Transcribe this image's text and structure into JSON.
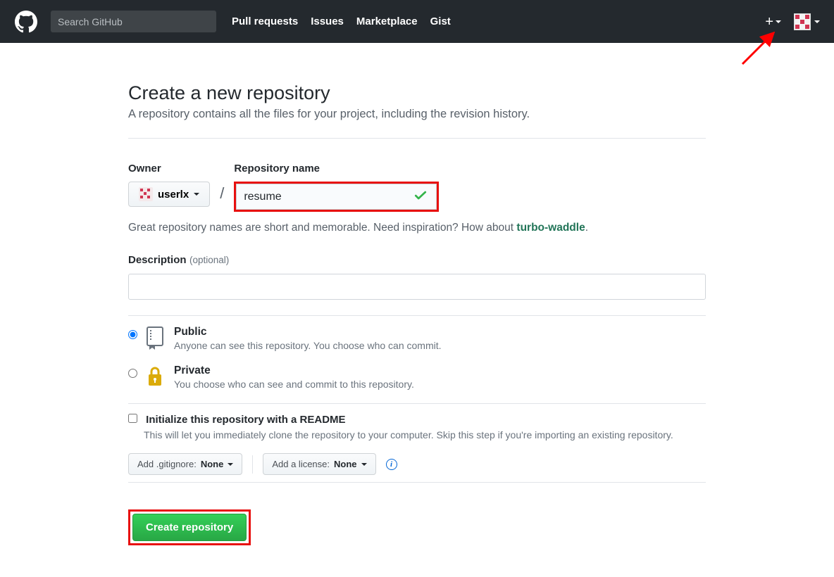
{
  "header": {
    "search_placeholder": "Search GitHub",
    "nav": {
      "pull_requests": "Pull requests",
      "issues": "Issues",
      "marketplace": "Marketplace",
      "gist": "Gist"
    }
  },
  "page": {
    "title": "Create a new repository",
    "lead": "A repository contains all the files for your project, including the revision history."
  },
  "owner": {
    "label": "Owner",
    "name": "userlx"
  },
  "repo_name": {
    "label": "Repository name",
    "value": "resume"
  },
  "name_hint": {
    "prefix": "Great repository names are short and memorable. Need inspiration? How about ",
    "suggestion": "turbo-waddle",
    "suffix": "."
  },
  "description": {
    "label": "Description",
    "optional": "(optional)",
    "value": ""
  },
  "visibility": {
    "public": {
      "title": "Public",
      "sub": "Anyone can see this repository. You choose who can commit."
    },
    "private": {
      "title": "Private",
      "sub": "You choose who can see and commit to this repository."
    }
  },
  "readme": {
    "label": "Initialize this repository with a README",
    "sub": "This will let you immediately clone the repository to your computer. Skip this step if you're importing an existing repository."
  },
  "selectors": {
    "gitignore_prefix": "Add .gitignore: ",
    "gitignore_value": "None",
    "license_prefix": "Add a license: ",
    "license_value": "None"
  },
  "create_label": "Create repository"
}
